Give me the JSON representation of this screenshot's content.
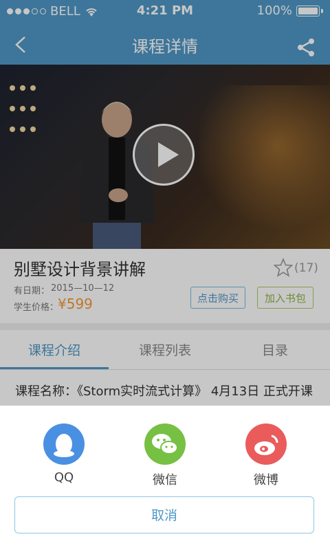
{
  "status_bar": {
    "carrier": "BELL",
    "time": "4:21 PM",
    "battery": "100%"
  },
  "nav": {
    "title": "课程详情",
    "back_icon": "chevron-left-icon",
    "share_icon": "share-icon"
  },
  "video": {
    "play_icon": "play-icon"
  },
  "course": {
    "title": "别墅设计背景讲解",
    "favorite_count": "(17)",
    "validity_label": "有日期：",
    "validity_value": "2015—10—12",
    "price_label": "学生价格：",
    "price_value": "¥599",
    "buy_label": "点击购买",
    "bag_label": "加入书包"
  },
  "tabs": [
    {
      "label": "课程介绍",
      "active": true
    },
    {
      "label": "课程列表",
      "active": false
    },
    {
      "label": "目录",
      "active": false
    }
  ],
  "description": "课程名称：《Storm实时流式计算》 4月13日 正式开课",
  "share_sheet": {
    "options": [
      {
        "label": "QQ",
        "color": "#4a90e2",
        "icon": "qq-icon"
      },
      {
        "label": "微信",
        "color": "#76c043",
        "icon": "wechat-icon"
      },
      {
        "label": "微博",
        "color": "#ea5b5b",
        "icon": "weibo-icon"
      }
    ],
    "cancel_label": "取消"
  },
  "colors": {
    "accent": "#4f98c6",
    "price": "#f29a3a",
    "bag": "#8fb444"
  }
}
